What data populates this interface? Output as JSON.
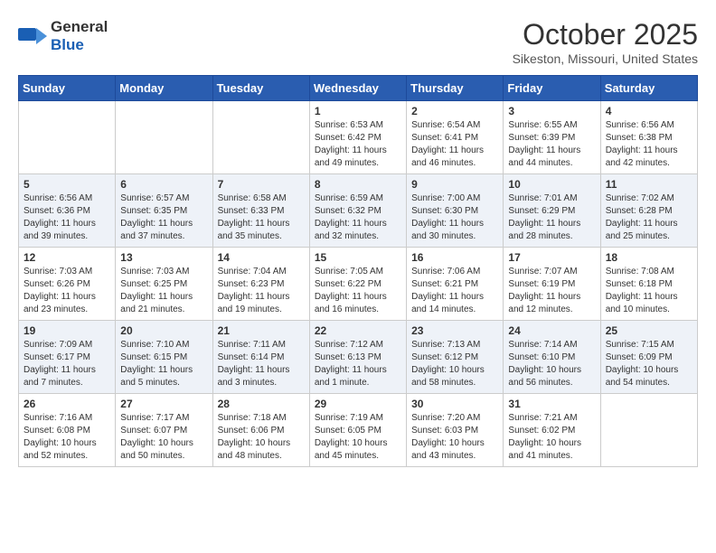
{
  "logo": {
    "general": "General",
    "blue": "Blue"
  },
  "header": {
    "month": "October 2025",
    "location": "Sikeston, Missouri, United States"
  },
  "weekdays": [
    "Sunday",
    "Monday",
    "Tuesday",
    "Wednesday",
    "Thursday",
    "Friday",
    "Saturday"
  ],
  "weeks": [
    [
      {
        "day": "",
        "info": ""
      },
      {
        "day": "",
        "info": ""
      },
      {
        "day": "",
        "info": ""
      },
      {
        "day": "1",
        "info": "Sunrise: 6:53 AM\nSunset: 6:42 PM\nDaylight: 11 hours and 49 minutes."
      },
      {
        "day": "2",
        "info": "Sunrise: 6:54 AM\nSunset: 6:41 PM\nDaylight: 11 hours and 46 minutes."
      },
      {
        "day": "3",
        "info": "Sunrise: 6:55 AM\nSunset: 6:39 PM\nDaylight: 11 hours and 44 minutes."
      },
      {
        "day": "4",
        "info": "Sunrise: 6:56 AM\nSunset: 6:38 PM\nDaylight: 11 hours and 42 minutes."
      }
    ],
    [
      {
        "day": "5",
        "info": "Sunrise: 6:56 AM\nSunset: 6:36 PM\nDaylight: 11 hours and 39 minutes."
      },
      {
        "day": "6",
        "info": "Sunrise: 6:57 AM\nSunset: 6:35 PM\nDaylight: 11 hours and 37 minutes."
      },
      {
        "day": "7",
        "info": "Sunrise: 6:58 AM\nSunset: 6:33 PM\nDaylight: 11 hours and 35 minutes."
      },
      {
        "day": "8",
        "info": "Sunrise: 6:59 AM\nSunset: 6:32 PM\nDaylight: 11 hours and 32 minutes."
      },
      {
        "day": "9",
        "info": "Sunrise: 7:00 AM\nSunset: 6:30 PM\nDaylight: 11 hours and 30 minutes."
      },
      {
        "day": "10",
        "info": "Sunrise: 7:01 AM\nSunset: 6:29 PM\nDaylight: 11 hours and 28 minutes."
      },
      {
        "day": "11",
        "info": "Sunrise: 7:02 AM\nSunset: 6:28 PM\nDaylight: 11 hours and 25 minutes."
      }
    ],
    [
      {
        "day": "12",
        "info": "Sunrise: 7:03 AM\nSunset: 6:26 PM\nDaylight: 11 hours and 23 minutes."
      },
      {
        "day": "13",
        "info": "Sunrise: 7:03 AM\nSunset: 6:25 PM\nDaylight: 11 hours and 21 minutes."
      },
      {
        "day": "14",
        "info": "Sunrise: 7:04 AM\nSunset: 6:23 PM\nDaylight: 11 hours and 19 minutes."
      },
      {
        "day": "15",
        "info": "Sunrise: 7:05 AM\nSunset: 6:22 PM\nDaylight: 11 hours and 16 minutes."
      },
      {
        "day": "16",
        "info": "Sunrise: 7:06 AM\nSunset: 6:21 PM\nDaylight: 11 hours and 14 minutes."
      },
      {
        "day": "17",
        "info": "Sunrise: 7:07 AM\nSunset: 6:19 PM\nDaylight: 11 hours and 12 minutes."
      },
      {
        "day": "18",
        "info": "Sunrise: 7:08 AM\nSunset: 6:18 PM\nDaylight: 11 hours and 10 minutes."
      }
    ],
    [
      {
        "day": "19",
        "info": "Sunrise: 7:09 AM\nSunset: 6:17 PM\nDaylight: 11 hours and 7 minutes."
      },
      {
        "day": "20",
        "info": "Sunrise: 7:10 AM\nSunset: 6:15 PM\nDaylight: 11 hours and 5 minutes."
      },
      {
        "day": "21",
        "info": "Sunrise: 7:11 AM\nSunset: 6:14 PM\nDaylight: 11 hours and 3 minutes."
      },
      {
        "day": "22",
        "info": "Sunrise: 7:12 AM\nSunset: 6:13 PM\nDaylight: 11 hours and 1 minute."
      },
      {
        "day": "23",
        "info": "Sunrise: 7:13 AM\nSunset: 6:12 PM\nDaylight: 10 hours and 58 minutes."
      },
      {
        "day": "24",
        "info": "Sunrise: 7:14 AM\nSunset: 6:10 PM\nDaylight: 10 hours and 56 minutes."
      },
      {
        "day": "25",
        "info": "Sunrise: 7:15 AM\nSunset: 6:09 PM\nDaylight: 10 hours and 54 minutes."
      }
    ],
    [
      {
        "day": "26",
        "info": "Sunrise: 7:16 AM\nSunset: 6:08 PM\nDaylight: 10 hours and 52 minutes."
      },
      {
        "day": "27",
        "info": "Sunrise: 7:17 AM\nSunset: 6:07 PM\nDaylight: 10 hours and 50 minutes."
      },
      {
        "day": "28",
        "info": "Sunrise: 7:18 AM\nSunset: 6:06 PM\nDaylight: 10 hours and 48 minutes."
      },
      {
        "day": "29",
        "info": "Sunrise: 7:19 AM\nSunset: 6:05 PM\nDaylight: 10 hours and 45 minutes."
      },
      {
        "day": "30",
        "info": "Sunrise: 7:20 AM\nSunset: 6:03 PM\nDaylight: 10 hours and 43 minutes."
      },
      {
        "day": "31",
        "info": "Sunrise: 7:21 AM\nSunset: 6:02 PM\nDaylight: 10 hours and 41 minutes."
      },
      {
        "day": "",
        "info": ""
      }
    ]
  ]
}
